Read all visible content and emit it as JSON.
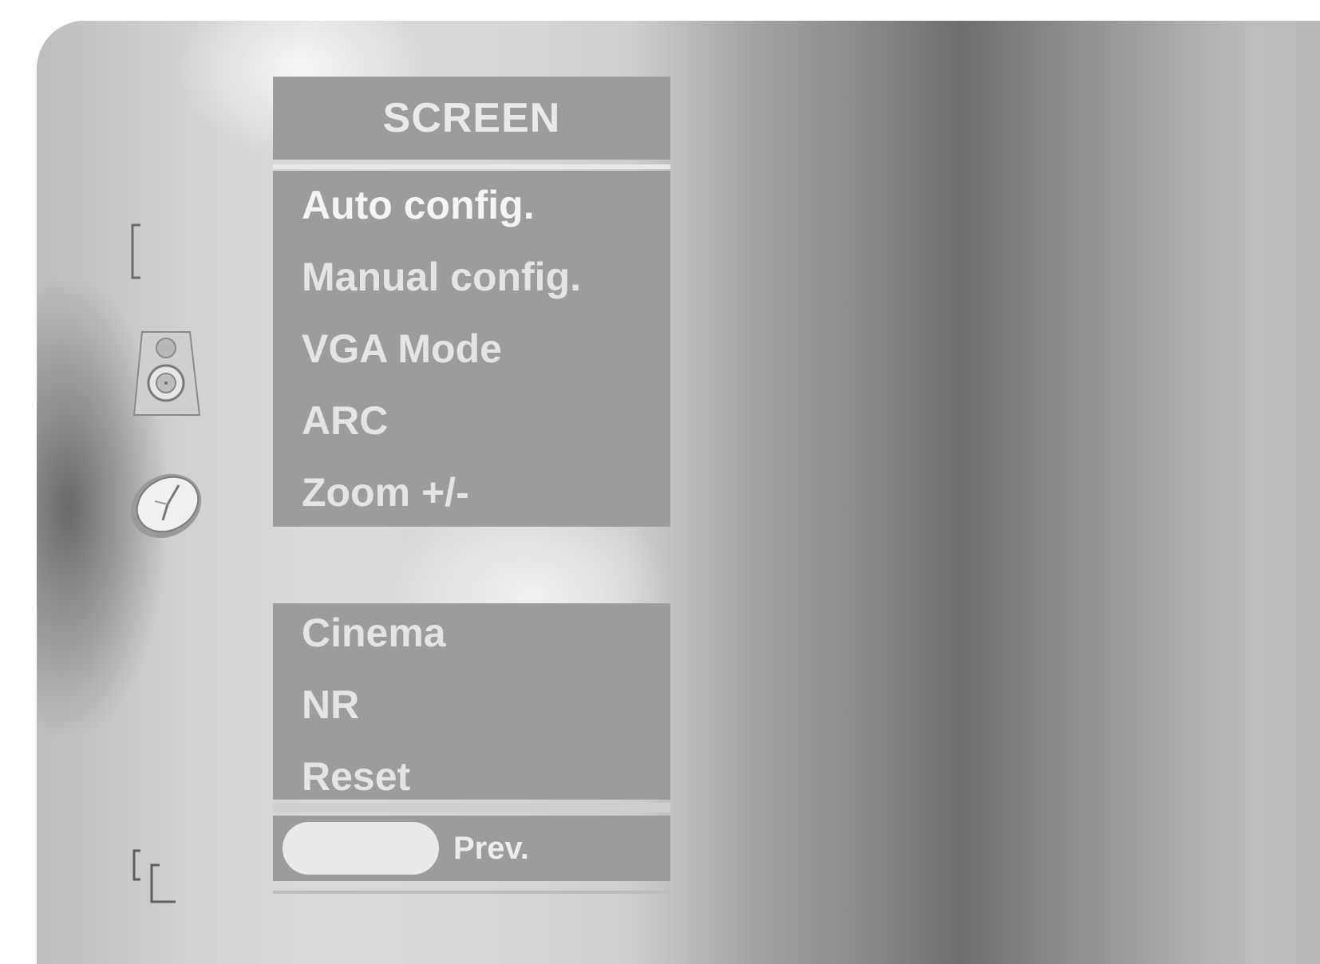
{
  "menu": {
    "title": "SCREEN",
    "items": [
      {
        "label": "Auto config."
      },
      {
        "label": "Manual config."
      },
      {
        "label": "VGA Mode"
      },
      {
        "label": "ARC"
      },
      {
        "label": "Zoom +/-"
      }
    ],
    "items_lower": [
      {
        "label": "Cinema"
      },
      {
        "label": "NR"
      },
      {
        "label": "Reset"
      }
    ],
    "prev_label": "Prev."
  },
  "side_icons": [
    {
      "name": "screen-bracket-icon"
    },
    {
      "name": "speaker-icon"
    },
    {
      "name": "clock-icon"
    },
    {
      "name": "special-bracket-icon"
    }
  ],
  "colors": {
    "panel": "#9c9c9c",
    "text": "#e4e4e4",
    "separator": "#e8e8e8"
  }
}
